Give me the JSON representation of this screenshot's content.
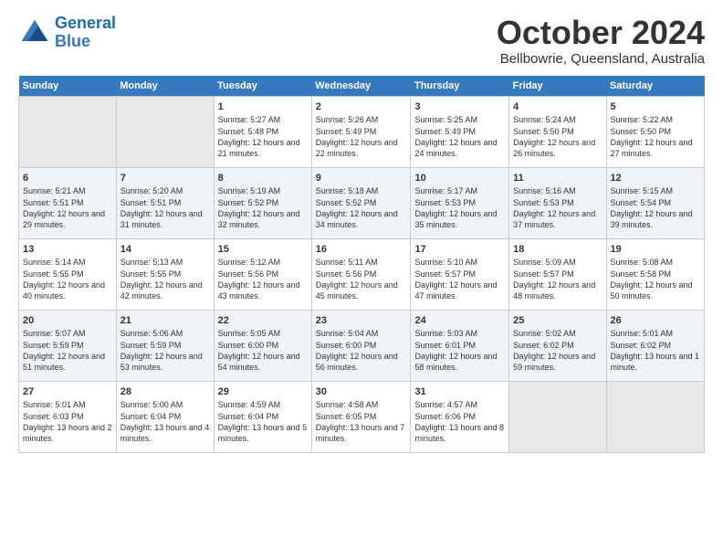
{
  "header": {
    "logo_line1": "General",
    "logo_line2": "Blue",
    "month": "October 2024",
    "location": "Bellbowrie, Queensland, Australia"
  },
  "days_of_week": [
    "Sunday",
    "Monday",
    "Tuesday",
    "Wednesday",
    "Thursday",
    "Friday",
    "Saturday"
  ],
  "weeks": [
    [
      {
        "day": "",
        "info": ""
      },
      {
        "day": "",
        "info": ""
      },
      {
        "day": "1",
        "info": "Sunrise: 5:27 AM\nSunset: 5:48 PM\nDaylight: 12 hours and 21 minutes."
      },
      {
        "day": "2",
        "info": "Sunrise: 5:26 AM\nSunset: 5:49 PM\nDaylight: 12 hours and 22 minutes."
      },
      {
        "day": "3",
        "info": "Sunrise: 5:25 AM\nSunset: 5:49 PM\nDaylight: 12 hours and 24 minutes."
      },
      {
        "day": "4",
        "info": "Sunrise: 5:24 AM\nSunset: 5:50 PM\nDaylight: 12 hours and 26 minutes."
      },
      {
        "day": "5",
        "info": "Sunrise: 5:22 AM\nSunset: 5:50 PM\nDaylight: 12 hours and 27 minutes."
      }
    ],
    [
      {
        "day": "6",
        "info": "Sunrise: 5:21 AM\nSunset: 5:51 PM\nDaylight: 12 hours and 29 minutes."
      },
      {
        "day": "7",
        "info": "Sunrise: 5:20 AM\nSunset: 5:51 PM\nDaylight: 12 hours and 31 minutes."
      },
      {
        "day": "8",
        "info": "Sunrise: 5:19 AM\nSunset: 5:52 PM\nDaylight: 12 hours and 32 minutes."
      },
      {
        "day": "9",
        "info": "Sunrise: 5:18 AM\nSunset: 5:52 PM\nDaylight: 12 hours and 34 minutes."
      },
      {
        "day": "10",
        "info": "Sunrise: 5:17 AM\nSunset: 5:53 PM\nDaylight: 12 hours and 35 minutes."
      },
      {
        "day": "11",
        "info": "Sunrise: 5:16 AM\nSunset: 5:53 PM\nDaylight: 12 hours and 37 minutes."
      },
      {
        "day": "12",
        "info": "Sunrise: 5:15 AM\nSunset: 5:54 PM\nDaylight: 12 hours and 39 minutes."
      }
    ],
    [
      {
        "day": "13",
        "info": "Sunrise: 5:14 AM\nSunset: 5:55 PM\nDaylight: 12 hours and 40 minutes."
      },
      {
        "day": "14",
        "info": "Sunrise: 5:13 AM\nSunset: 5:55 PM\nDaylight: 12 hours and 42 minutes."
      },
      {
        "day": "15",
        "info": "Sunrise: 5:12 AM\nSunset: 5:56 PM\nDaylight: 12 hours and 43 minutes."
      },
      {
        "day": "16",
        "info": "Sunrise: 5:11 AM\nSunset: 5:56 PM\nDaylight: 12 hours and 45 minutes."
      },
      {
        "day": "17",
        "info": "Sunrise: 5:10 AM\nSunset: 5:57 PM\nDaylight: 12 hours and 47 minutes."
      },
      {
        "day": "18",
        "info": "Sunrise: 5:09 AM\nSunset: 5:57 PM\nDaylight: 12 hours and 48 minutes."
      },
      {
        "day": "19",
        "info": "Sunrise: 5:08 AM\nSunset: 5:58 PM\nDaylight: 12 hours and 50 minutes."
      }
    ],
    [
      {
        "day": "20",
        "info": "Sunrise: 5:07 AM\nSunset: 5:59 PM\nDaylight: 12 hours and 51 minutes."
      },
      {
        "day": "21",
        "info": "Sunrise: 5:06 AM\nSunset: 5:59 PM\nDaylight: 12 hours and 53 minutes."
      },
      {
        "day": "22",
        "info": "Sunrise: 5:05 AM\nSunset: 6:00 PM\nDaylight: 12 hours and 54 minutes."
      },
      {
        "day": "23",
        "info": "Sunrise: 5:04 AM\nSunset: 6:00 PM\nDaylight: 12 hours and 56 minutes."
      },
      {
        "day": "24",
        "info": "Sunrise: 5:03 AM\nSunset: 6:01 PM\nDaylight: 12 hours and 58 minutes."
      },
      {
        "day": "25",
        "info": "Sunrise: 5:02 AM\nSunset: 6:02 PM\nDaylight: 12 hours and 59 minutes."
      },
      {
        "day": "26",
        "info": "Sunrise: 5:01 AM\nSunset: 6:02 PM\nDaylight: 13 hours and 1 minute."
      }
    ],
    [
      {
        "day": "27",
        "info": "Sunrise: 5:01 AM\nSunset: 6:03 PM\nDaylight: 13 hours and 2 minutes."
      },
      {
        "day": "28",
        "info": "Sunrise: 5:00 AM\nSunset: 6:04 PM\nDaylight: 13 hours and 4 minutes."
      },
      {
        "day": "29",
        "info": "Sunrise: 4:59 AM\nSunset: 6:04 PM\nDaylight: 13 hours and 5 minutes."
      },
      {
        "day": "30",
        "info": "Sunrise: 4:58 AM\nSunset: 6:05 PM\nDaylight: 13 hours and 7 minutes."
      },
      {
        "day": "31",
        "info": "Sunrise: 4:57 AM\nSunset: 6:06 PM\nDaylight: 13 hours and 8 minutes."
      },
      {
        "day": "",
        "info": ""
      },
      {
        "day": "",
        "info": ""
      }
    ]
  ]
}
